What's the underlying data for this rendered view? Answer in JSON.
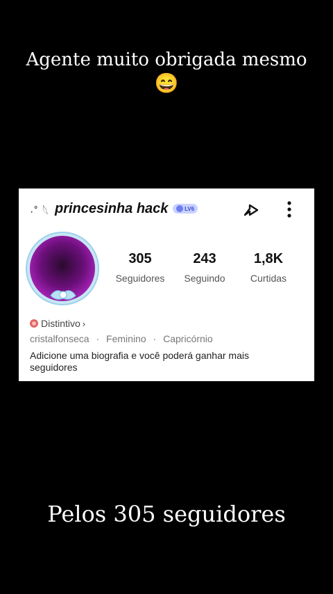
{
  "caption_top": "Agente muito obrigada mesmo",
  "caption_emoji": "😄",
  "profile": {
    "decor_prefix": "·˚ 𓆩",
    "username": "princesinha hack",
    "level_badge": "LV6",
    "stats": [
      {
        "value": "305",
        "label": "Seguidores"
      },
      {
        "value": "243",
        "label": "Seguindo"
      },
      {
        "value": "1,8K",
        "label": "Curtidas"
      }
    ],
    "badge_label": "Distintivo",
    "badge_chevron": "›",
    "meta": [
      "cristalfonseca",
      "Feminino",
      "Capricórnio"
    ],
    "meta_separator": "·",
    "bio": "Adicione uma biografia e você poderá ganhar mais seguidores"
  },
  "caption_bottom": "Pelos 305 seguidores",
  "colors": {
    "background": "#000000",
    "card": "#ffffff",
    "level_badge": "#c9d2ff",
    "badge_red": "#e06565"
  },
  "icons": [
    "share-icon",
    "more-vertical-icon",
    "badge-icon",
    "chevron-right-icon"
  ]
}
